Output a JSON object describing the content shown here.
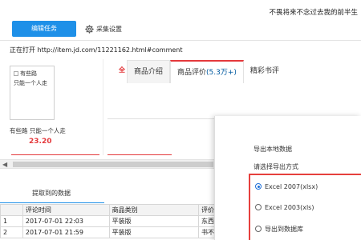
{
  "banner": {
    "motto": "不畏将来不念过去我的前半生"
  },
  "toolbar": {
    "edit_task_label": "编辑任务",
    "collect_settings_label": "采集设置"
  },
  "address": {
    "prefix": "正在打开",
    "url": "http://item.jd.com/11221162.html#comment"
  },
  "product": {
    "thumb_title": "有些路",
    "thumb_subtitle": "只能一个人走",
    "name": "有些路 只能一个人走",
    "price": "23.20"
  },
  "jd_tabs": {
    "first_partial": "全",
    "items": [
      {
        "label": "商品介绍"
      },
      {
        "label": "商品评价",
        "count": "(5.3万+)"
      },
      {
        "label": "精彩书评"
      }
    ]
  },
  "data_section": {
    "title": "提取到的数据"
  },
  "table": {
    "headers": [
      "",
      "评论时间",
      "商品类别",
      "评价"
    ],
    "rows": [
      [
        "1",
        "2017-07-01 22:03",
        "平装版",
        "东西"
      ],
      [
        "2",
        "2017-07-01 21:59",
        "平装版",
        "书不"
      ]
    ]
  },
  "export": {
    "heading": "导出本地数据",
    "prompt": "请选择导出方式",
    "options": [
      {
        "label": "Excel 2007(xlsx)",
        "selected": true
      },
      {
        "label": "Excel 2003(xls)",
        "selected": false
      },
      {
        "label": "导出到数据库",
        "selected": false
      }
    ]
  },
  "colors": {
    "accent_blue": "#1e90e8",
    "jd_red": "#e4393c",
    "highlight_box": "#e6403d"
  }
}
